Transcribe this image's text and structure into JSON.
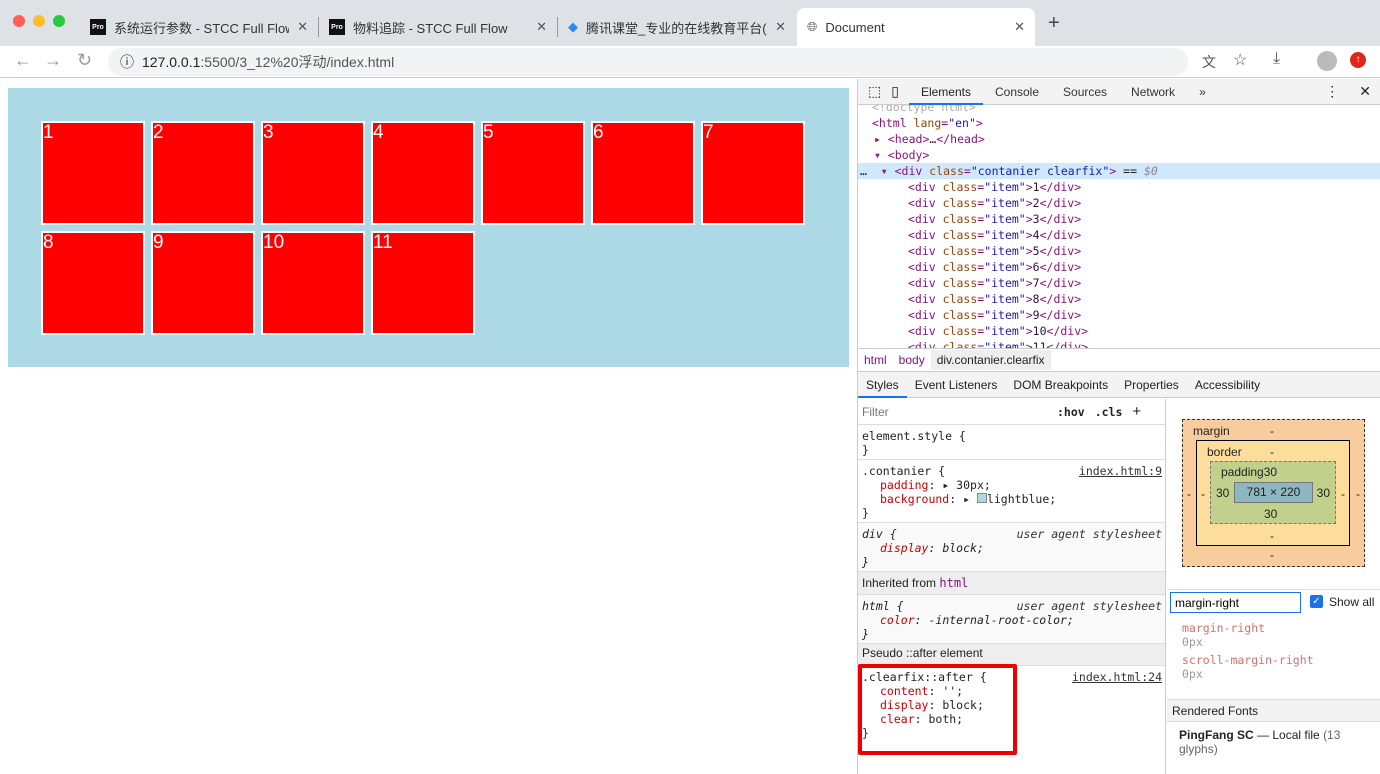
{
  "browser": {
    "tabs": [
      {
        "title": "系统运行参数 - STCC Full Flow",
        "icon": "Pro"
      },
      {
        "title": "物料追踪 - STCC Full Flow",
        "icon": "Pro"
      },
      {
        "title": "腾讯课堂_专业的在线教育平台(k",
        "icon": "tencent-icon"
      },
      {
        "title": "Document",
        "icon": "globe-icon"
      }
    ],
    "new_tab": "+",
    "url_host": "127.0.0.1",
    "url_rest": ":5500/3_12%20浮动/index.html"
  },
  "page": {
    "items": [
      "1",
      "2",
      "3",
      "4",
      "5",
      "6",
      "7",
      "8",
      "9",
      "10",
      "11"
    ],
    "container_color": "#add8e6",
    "item_color": "#ff0000"
  },
  "devtools": {
    "tabs": [
      "Elements",
      "Console",
      "Sources",
      "Network"
    ],
    "more": "»",
    "tree": {
      "doctype": "<!doctype html>",
      "items": [
        "1",
        "2",
        "3",
        "4",
        "5",
        "6",
        "7",
        "8",
        "9",
        "10",
        "11"
      ]
    },
    "breadcrumb": [
      "html",
      "body",
      "div.contanier.clearfix"
    ],
    "style_tabs": [
      "Styles",
      "Event Listeners",
      "DOM Breakpoints",
      "Properties",
      "Accessibility"
    ],
    "filter_placeholder": "Filter",
    "hov": ":hov",
    "cls": ".cls",
    "rules": {
      "element_style": "element.style {",
      "contanier_sel": ".contanier {",
      "contanier_src": "index.html:9",
      "padding_val": "30px;",
      "background_val": "lightblue;",
      "div_sel": "div {",
      "ua": "user agent stylesheet",
      "display_val": "block;",
      "inherited": "Inherited from ",
      "inherited_el": "html",
      "html_sel": "html {",
      "color_val": "-internal-root-color;",
      "pseudo": "Pseudo ::after element",
      "clearfix_sel": ".clearfix::after {",
      "clearfix_src": "index.html:24",
      "content_val": "'';",
      "clear_val": "both;"
    },
    "box_model": {
      "margin": "margin",
      "border": "border",
      "padding": "padding30",
      "size": "781 × 220",
      "pad": "30",
      "dash": "-"
    },
    "computed_filter": "margin-right",
    "show_all": "Show all",
    "computed": [
      {
        "name": "margin-right",
        "value": "0px"
      },
      {
        "name": "scroll-margin-right",
        "value": "0px"
      }
    ],
    "rendered_fonts": "Rendered Fonts",
    "font_name": "PingFang SC",
    "font_src": "—  Local file",
    "font_glyphs": "(13 glyphs)"
  }
}
